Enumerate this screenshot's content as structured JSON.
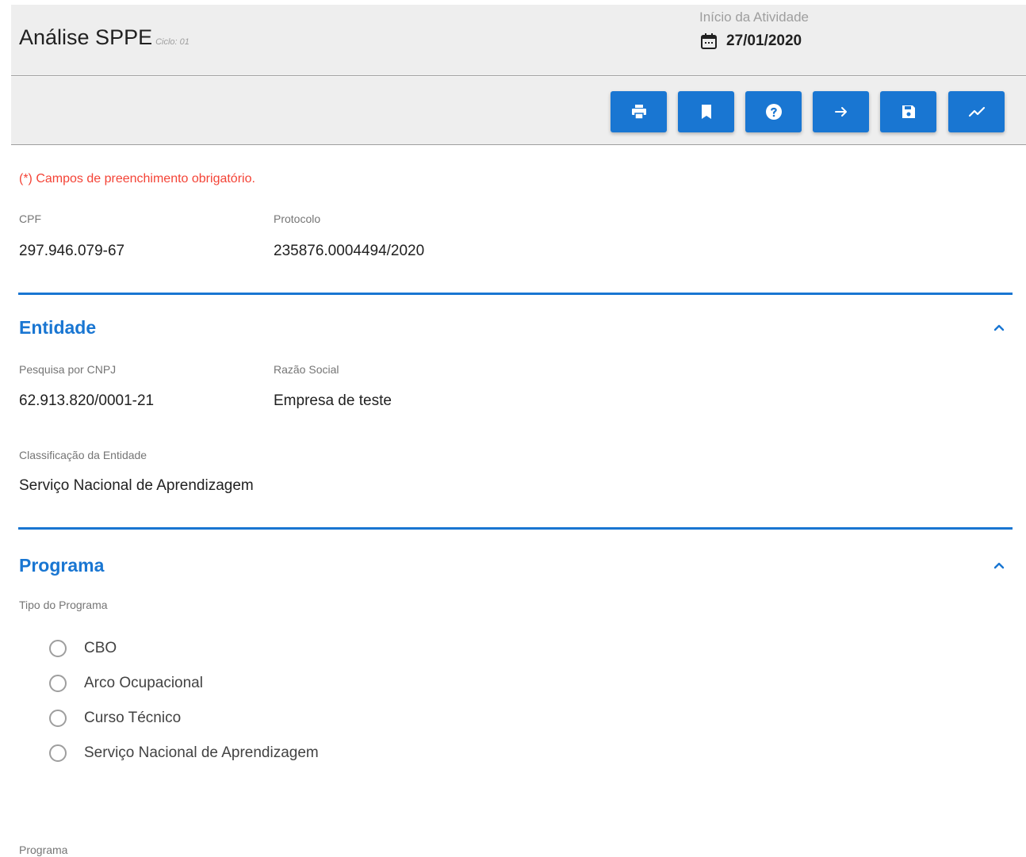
{
  "header": {
    "title": "Análise SPPE",
    "cycle": "Ciclo: 01",
    "start_label": "Início da Atividade",
    "start_date": "27/01/2020",
    "start_icon": "calendar-icon"
  },
  "toolbar": {
    "buttons": [
      {
        "name": "print-button",
        "icon": "printer-icon"
      },
      {
        "name": "bookmark-button",
        "icon": "bookmark-icon"
      },
      {
        "name": "help-button",
        "icon": "help-icon"
      },
      {
        "name": "forward-button",
        "icon": "arrow-right-icon"
      },
      {
        "name": "save-button",
        "icon": "floppy-icon"
      },
      {
        "name": "chart-button",
        "icon": "trend-icon"
      }
    ],
    "button_color": "#1976d2"
  },
  "form": {
    "required_note": "(*) Campos de preenchimento obrigatório.",
    "cpf_label": "CPF",
    "cpf_value": "297.946.079-67",
    "protocol_label": "Protocolo",
    "protocol_value": "235876.0004494/2020"
  },
  "entidade": {
    "title": "Entidade",
    "cnpj_label": "Pesquisa por CNPJ",
    "cnpj_value": "62.913.820/0001-21",
    "razao_label": "Razão Social",
    "razao_value": "Empresa de teste",
    "classificacao_label": "Classificação da Entidade",
    "classificacao_value": "Serviço Nacional de Aprendizagem"
  },
  "programa": {
    "title": "Programa",
    "tipo_label": "Tipo do Programa",
    "options": [
      "CBO",
      "Arco Ocupacional",
      "Curso Técnico",
      "Serviço Nacional de Aprendizagem"
    ],
    "programa_label": "Programa"
  },
  "colors": {
    "accent": "#1976d2",
    "required": "#f44336",
    "header_bg": "#eeeeee"
  }
}
